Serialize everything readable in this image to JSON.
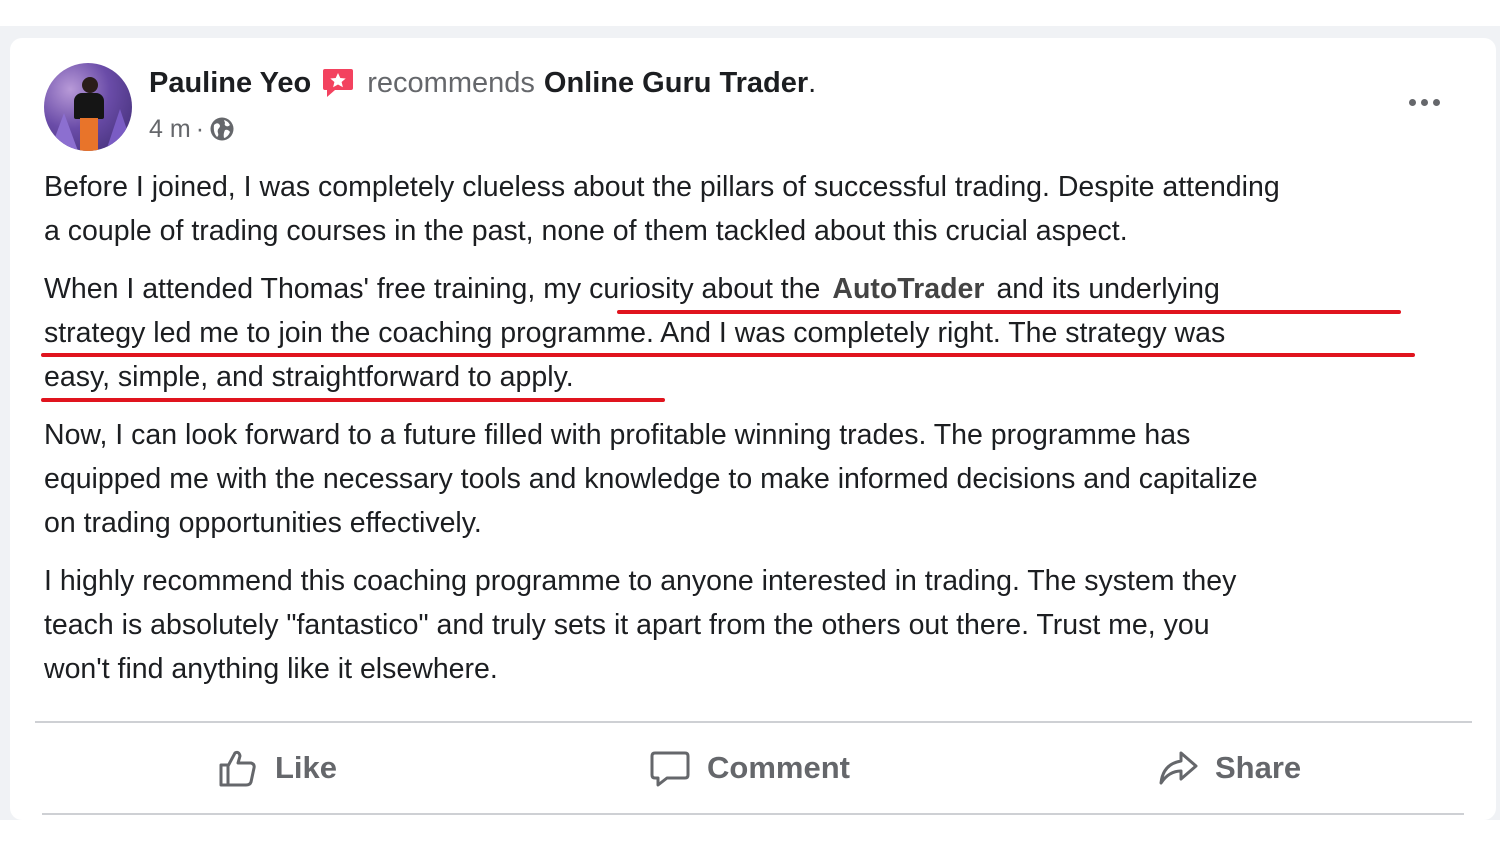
{
  "post": {
    "author": "Pauline Yeo",
    "action_text": "recommends",
    "page_name": "Online Guru Trader",
    "page_suffix": ".",
    "time": "4 m",
    "separator": "·",
    "icons": {
      "avatar": "profile-photo",
      "recommend": "recommend-flag-icon",
      "audience": "globe-icon",
      "more": "more-options-icon"
    },
    "paragraphs": [
      {
        "lines": [
          "Before I joined, I was completely clueless about the pillars of successful trading. Despite attending",
          "a couple of trading courses in the past, none of them tackled about this crucial aspect."
        ]
      },
      {
        "line1_before": "When I attended Thomas' free training, my curiosity about the",
        "line1_brand": "AutoTrader",
        "line1_after": "and its underlying",
        "line2": "strategy led me to join the coaching programme. And I was completely right. The strategy was",
        "line3": "easy, simple, and straightforward to apply."
      },
      {
        "lines": [
          "Now, I can look forward to a future filled with profitable winning trades. The programme has",
          "equipped me with the necessary tools and knowledge to make informed decisions and capitalize",
          "on trading opportunities effectively."
        ]
      },
      {
        "lines": [
          "I highly recommend this coaching programme to anyone interested in trading. The system they",
          "teach is absolutely \"fantastico\" and truly sets it apart from the others out there. Trust me, you",
          "won't find anything like it elsewhere."
        ]
      }
    ],
    "highlight_color": "#e0141e"
  },
  "actions": {
    "like": "Like",
    "comment": "Comment",
    "share": "Share"
  }
}
